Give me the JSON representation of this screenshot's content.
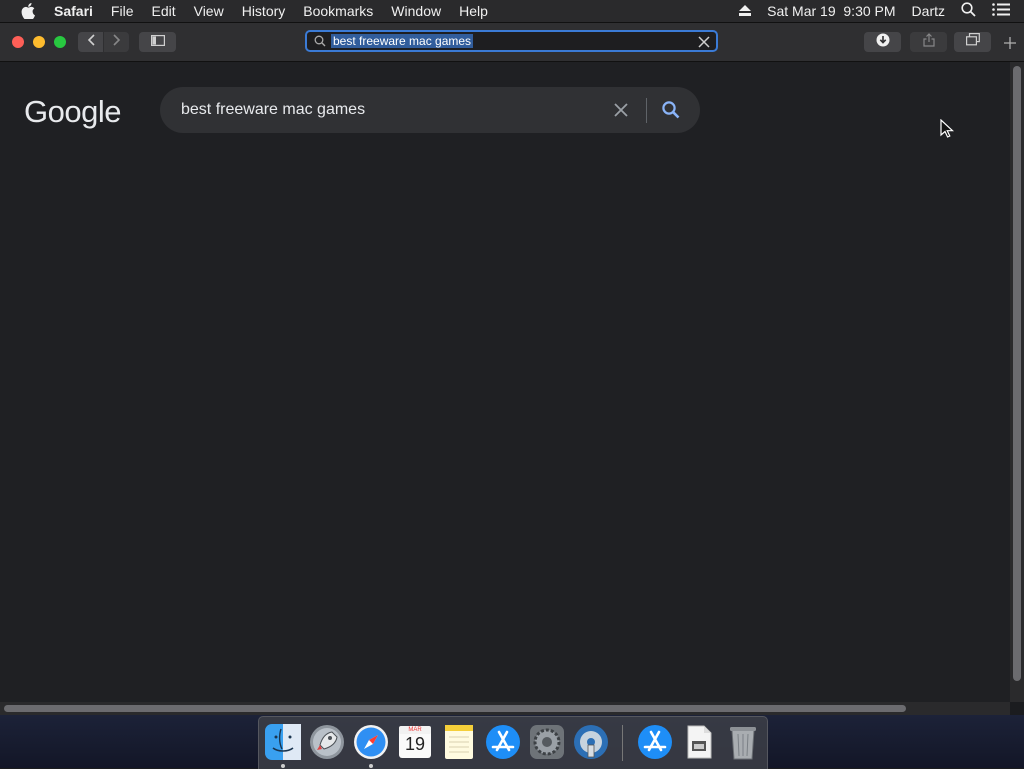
{
  "menubar": {
    "apple_icon": "apple-logo-icon",
    "app_name": "Safari",
    "items": [
      "File",
      "Edit",
      "View",
      "History",
      "Bookmarks",
      "Window",
      "Help"
    ],
    "datetime": "Sat Mar 19  9:30 PM",
    "user": "Dartz",
    "status_icons": [
      "eject-icon",
      "spotlight-search-icon",
      "notification-center-icon"
    ]
  },
  "toolbar": {
    "address_text": "best freeware mac games",
    "icons": [
      "back-arrow-icon",
      "forward-arrow-icon",
      "sidebar-icon",
      "download-icon",
      "share-icon",
      "tabs-overview-icon",
      "new-tab-icon"
    ]
  },
  "page": {
    "logo": "Google",
    "search_query": "best freeware mac games"
  },
  "dock": {
    "calendar_month": "MAR",
    "calendar_day": "19",
    "apps": [
      "Finder",
      "Launchpad",
      "Safari",
      "Calendar",
      "Notes",
      "App Store",
      "System Preferences",
      "Disk Utility",
      "App Store (Downloads)",
      "Documents",
      "Trash"
    ]
  },
  "colors": {
    "page_bg": "#1f2023",
    "searchbox_bg": "#303134",
    "accent_blue": "#3b7bd6",
    "search_icon_blue": "#8ab4f8"
  }
}
